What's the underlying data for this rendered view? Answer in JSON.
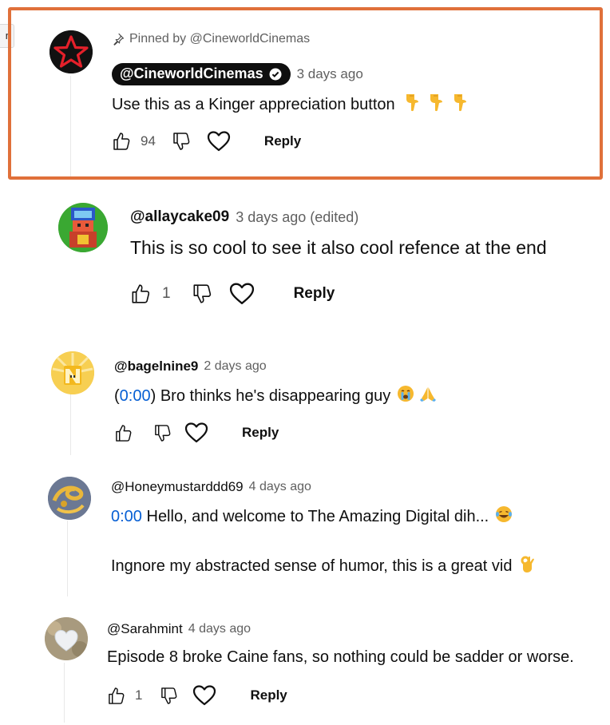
{
  "pinned_comment": {
    "pinned_label": "Pinned by @CineworldCinemas",
    "author": "@CineworldCinemas",
    "time": "3 days ago",
    "text": "Use this as a Kinger appreciation button",
    "likes": "94",
    "reply_label": "Reply",
    "emoji": [
      "pointing-down",
      "pointing-down",
      "pointing-down"
    ]
  },
  "comments": [
    {
      "author": "@allaycake09",
      "time": "3 days ago (edited)",
      "text": "This is so cool to see it also cool refence at the end",
      "likes": "1",
      "reply_label": "Reply"
    },
    {
      "author": "@bagelnine9",
      "time": "2 days ago",
      "timestamp": "0:00",
      "text_before": "(",
      "text_after": ") Bro thinks he's disappearing guy",
      "likes": "",
      "reply_label": "Reply",
      "emoji": [
        "crying-face",
        "folded-hands"
      ]
    },
    {
      "author": "@Honeymustarddd69",
      "time": "4 days ago",
      "timestamp": "0:00",
      "text_line1": " Hello, and welcome to The Amazing Digital dih...",
      "text_line2": "Ingnore my abstracted sense of humor, this is a great vid",
      "emoji": [
        "tears-of-joy",
        "ok-hand"
      ]
    },
    {
      "author": "@Sarahmint",
      "time": "4 days ago",
      "text": "Episode 8 broke Caine fans, so nothing could be sadder or worse.",
      "likes": "1",
      "reply_label": "Reply"
    }
  ],
  "edge_tab_label": "n",
  "colors": {
    "highlight_border": "#e0703a",
    "link": "#065fd4",
    "owner_chip": "#0f0f0f",
    "emoji_yellow": "#f6b82e"
  }
}
